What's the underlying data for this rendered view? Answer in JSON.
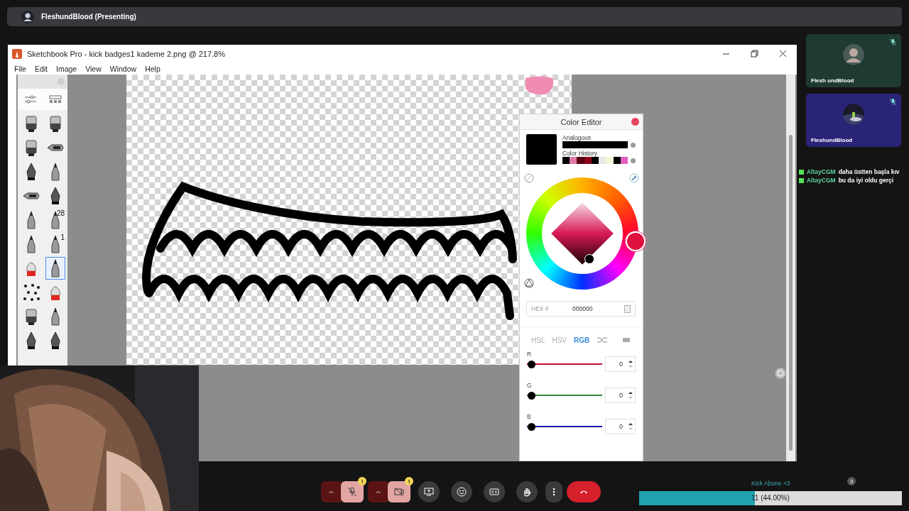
{
  "presenter": {
    "label": "FleshundBlood (Presenting)"
  },
  "window": {
    "title": "Sketchbook Pro - kick badges1 kademe 2.png @ 217.8%"
  },
  "menu": [
    "File",
    "Edit",
    "Image",
    "View",
    "Window",
    "Help"
  ],
  "tools": [
    {
      "kind": "marker",
      "selected": false
    },
    {
      "kind": "marker",
      "selected": false
    },
    {
      "kind": "marker",
      "selected": false
    },
    {
      "kind": "airbrush",
      "selected": false
    },
    {
      "kind": "pen",
      "selected": false
    },
    {
      "kind": "pencil",
      "selected": false
    },
    {
      "kind": "airbrush",
      "selected": false
    },
    {
      "kind": "pen",
      "selected": false
    },
    {
      "kind": "pencil",
      "selected": false
    },
    {
      "kind": "pencil",
      "selected": false,
      "label": "28"
    },
    {
      "kind": "pencil",
      "selected": false
    },
    {
      "kind": "pencil",
      "selected": false,
      "label": "1"
    },
    {
      "kind": "brush",
      "selected": false
    },
    {
      "kind": "pencil",
      "selected": true
    },
    {
      "kind": "stars",
      "selected": false
    },
    {
      "kind": "brush",
      "selected": false
    },
    {
      "kind": "marker",
      "selected": false
    },
    {
      "kind": "pencil",
      "selected": false
    },
    {
      "kind": "pen",
      "selected": false
    },
    {
      "kind": "pen",
      "selected": false
    }
  ],
  "color_editor": {
    "title": "Color Editor",
    "analogous_label": "Analogous",
    "history_label": "Color History",
    "history": [
      {
        "color": "#000000"
      },
      {
        "color": "#e07aa8"
      },
      {
        "color": "#5a0010"
      },
      {
        "color": "#8a0018"
      },
      {
        "color": "#000000"
      },
      {
        "color": "#e8e8e0"
      },
      {
        "color": "#f4f4d8"
      },
      {
        "color": "#000000"
      },
      {
        "color": "#e060c0"
      }
    ],
    "hex_label": "HEX #",
    "hex_value": "000000",
    "modes": [
      {
        "label": "HSL",
        "selected": false
      },
      {
        "label": "HSV",
        "selected": false
      },
      {
        "label": "RGB",
        "selected": true
      }
    ],
    "channels": [
      {
        "label": "R",
        "color": "#c8102e",
        "level": 0,
        "value": "0"
      },
      {
        "label": "G",
        "color": "#2e8b3a",
        "level": 0,
        "value": "0"
      },
      {
        "label": "B",
        "color": "#1a1ab0",
        "level": 0,
        "value": "0"
      }
    ]
  },
  "participants": [
    {
      "name": "Flesh undBlood",
      "color": "#1f3a33",
      "muted": true,
      "kind": "person"
    },
    {
      "name": "FleshundBlood",
      "color": "#2a2478",
      "muted": true,
      "kind": "picture"
    }
  ],
  "chat": [
    {
      "user": "AltayCGM",
      "text": "daha üstten başla kıv"
    },
    {
      "user": "AltayCGM",
      "text": "bu da iyi oldu gerçi"
    }
  ],
  "toolbar": {
    "mic": {
      "on": false,
      "warning": "!"
    },
    "camera": {
      "on": false,
      "warning": "!"
    }
  },
  "goal": {
    "title": "Kick Abone <3",
    "value": "11 (44.00%)",
    "level": 0.44,
    "badge": "3"
  }
}
